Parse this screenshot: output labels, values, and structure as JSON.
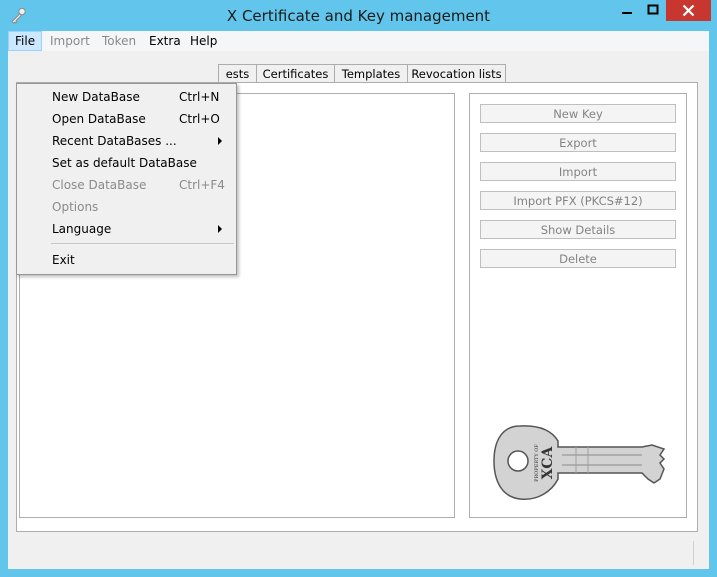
{
  "window": {
    "title": "X Certificate and Key management"
  },
  "menubar": {
    "items": [
      {
        "label": "File",
        "disabled": false,
        "active": true
      },
      {
        "label": "Import",
        "disabled": true
      },
      {
        "label": "Token",
        "disabled": true
      },
      {
        "label": "Extra",
        "disabled": false
      },
      {
        "label": "Help",
        "disabled": false
      }
    ]
  },
  "file_menu": {
    "items": [
      {
        "label": "New DataBase",
        "shortcut": "Ctrl+N",
        "disabled": false
      },
      {
        "label": "Open DataBase",
        "shortcut": "Ctrl+O",
        "disabled": false
      },
      {
        "label": "Recent DataBases ...",
        "shortcut": "",
        "submenu": true
      },
      {
        "label": "Set as default DataBase",
        "shortcut": "",
        "disabled": false
      },
      {
        "label": "Close DataBase",
        "shortcut": "Ctrl+F4",
        "disabled": true
      },
      {
        "label": "Options",
        "shortcut": "",
        "disabled": true
      },
      {
        "label": "Language",
        "shortcut": "",
        "submenu": true
      },
      {
        "label": "Exit",
        "shortcut": "",
        "disabled": false
      }
    ]
  },
  "tabs": [
    {
      "label": "ests"
    },
    {
      "label": "Certificates"
    },
    {
      "label": "Templates"
    },
    {
      "label": "Revocation lists"
    }
  ],
  "side_buttons": [
    {
      "label": "New Key"
    },
    {
      "label": "Export"
    },
    {
      "label": "Import"
    },
    {
      "label": "Import PFX (PKCS#12)"
    },
    {
      "label": "Show Details"
    },
    {
      "label": "Delete"
    }
  ],
  "key_image": {
    "line1": "PROPERTY OF",
    "line2": "XCA"
  },
  "colors": {
    "titlebar": "#62c6ec",
    "close_button": "#c7372f",
    "menu_active": "#cce8ff"
  }
}
